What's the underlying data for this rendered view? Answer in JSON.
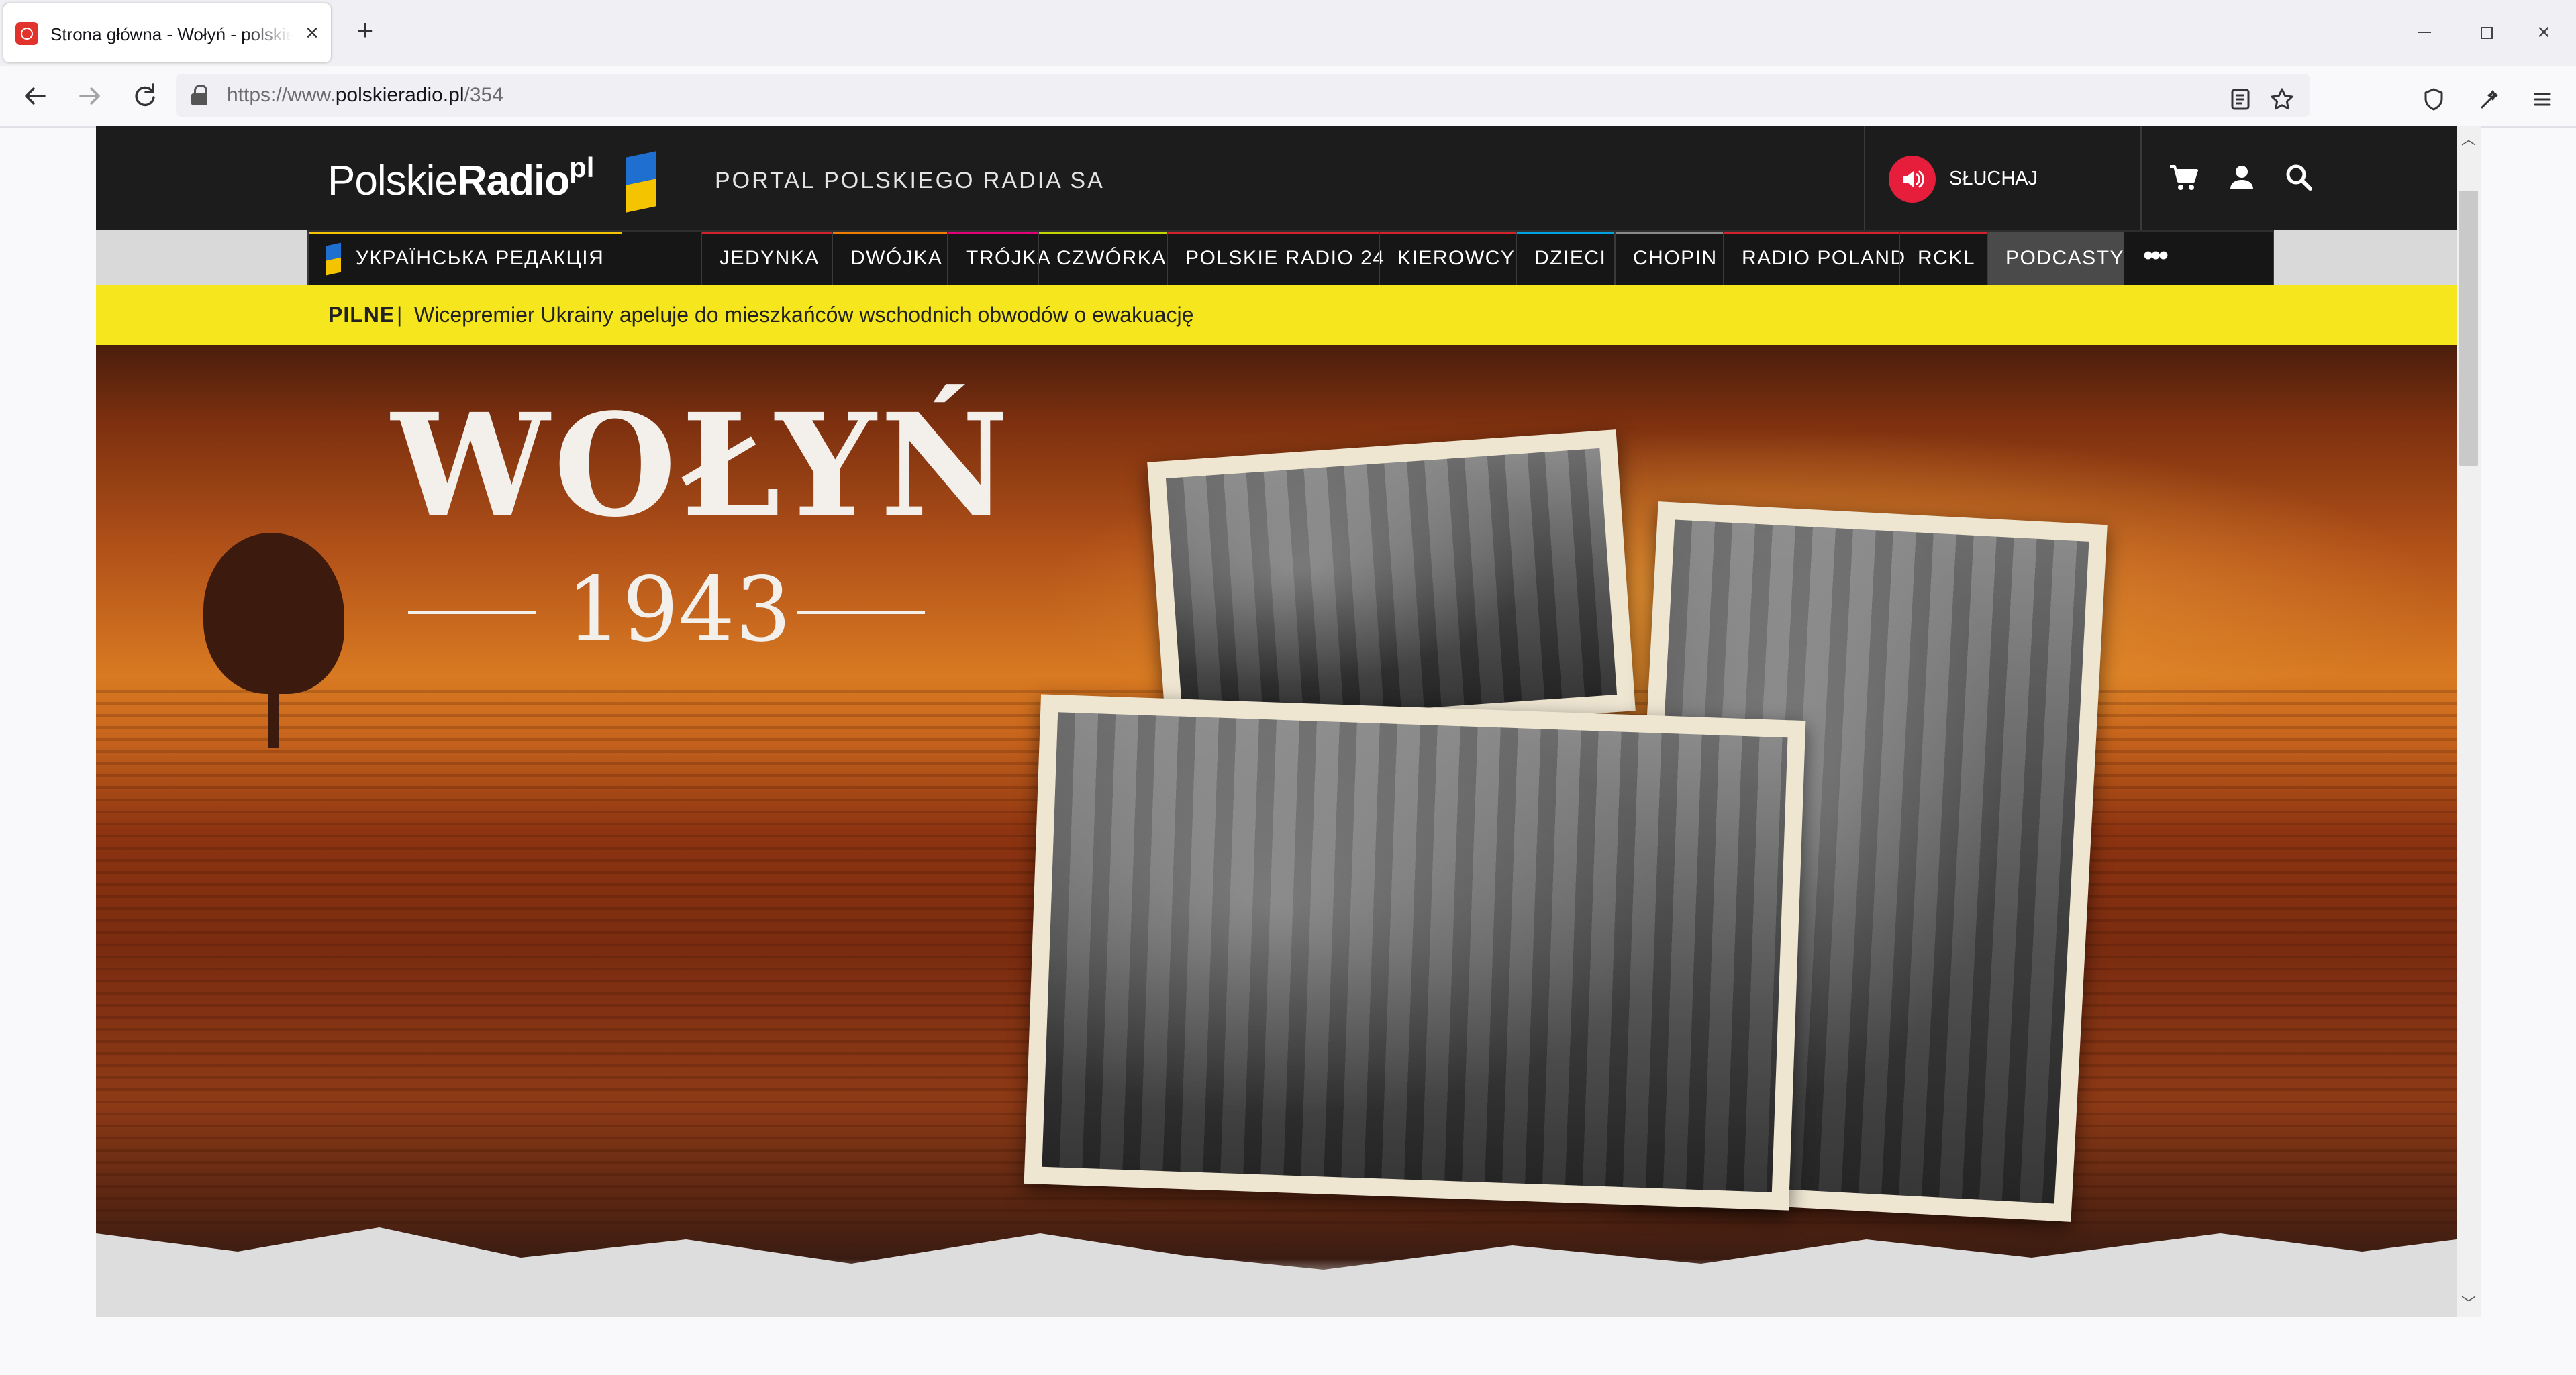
{
  "browser": {
    "tab_title": "Strona główna - Wołyń - polskieradio.pl",
    "url_prefix": "https://www.",
    "url_host": "polskieradio.pl",
    "url_path": "/354"
  },
  "icons": {
    "favicon": "polskieradio-favicon",
    "back": "arrow-left-icon",
    "forward": "arrow-right-icon",
    "reload": "reload-icon",
    "lock": "lock-icon",
    "reader": "reader-view-icon",
    "bookmark": "star-icon",
    "shield": "shield-icon",
    "extensions": "extensions-icon",
    "menu": "hamburger-menu-icon",
    "cart": "cart-icon",
    "user": "user-icon",
    "search": "search-icon",
    "speaker": "speaker-icon"
  },
  "header": {
    "logo_polskie": "Polskie",
    "logo_radio": "Radio",
    "logo_pl": "pl",
    "portal_title": "PORTAL POLSKIEGO RADIA SA",
    "listen_label": "SŁUCHAJ"
  },
  "menu": {
    "items": [
      {
        "label": "УКРАЇНСЬКА РЕДАКЦІЯ",
        "accent": "#f5c400"
      },
      {
        "label": "JEDYNKA",
        "accent": "#d2232a"
      },
      {
        "label": "DWÓJKA",
        "accent": "#ef7d00"
      },
      {
        "label": "TRÓJKA",
        "accent": "#e0007a"
      },
      {
        "label": "CZWÓRKA",
        "accent": "#c3d600"
      },
      {
        "label": "POLSKIE RADIO 24",
        "accent": "#d2232a"
      },
      {
        "label": "KIEROWCY",
        "accent": "#d2232a"
      },
      {
        "label": "DZIECI",
        "accent": "#00a3e0"
      },
      {
        "label": "CHOPIN",
        "accent": "#8a8a8a"
      },
      {
        "label": "RADIO POLAND",
        "accent": "#d2232a"
      },
      {
        "label": "RCKL",
        "accent": "#d2232a"
      },
      {
        "label": "PODCASTY",
        "accent": "#5f5f5f"
      }
    ],
    "more": "•••"
  },
  "alert": {
    "label": "PILNE",
    "separator": "|",
    "text": "Wicepremier Ukrainy apeluje do mieszkańców wschodnich obwodów o ewakuację"
  },
  "hero": {
    "title": "WOŁYŃ",
    "year": "1943"
  },
  "colors": {
    "header_bg": "#1c1c1c",
    "alert_bg": "#f6e61e",
    "listen_red": "#e61e3c",
    "flag_blue": "#1e6fd0",
    "flag_yellow": "#f5c400"
  }
}
